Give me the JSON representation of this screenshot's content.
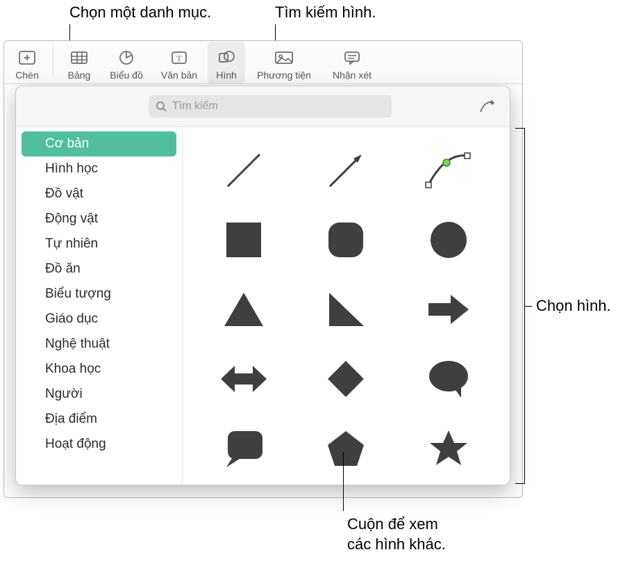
{
  "callouts": {
    "choose_category": "Chọn một danh mục.",
    "search_shapes": "Tìm kiếm hình.",
    "choose_shape": "Chọn hình.",
    "scroll_more": "Cuộn để xem\ncác hình khác."
  },
  "toolbar": {
    "insert": "Chèn",
    "table": "Bảng",
    "chart": "Biểu đồ",
    "text": "Văn bản",
    "shape": "Hình",
    "media": "Phương tiện",
    "comment": "Nhận xét"
  },
  "popover": {
    "search_placeholder": "Tìm kiếm",
    "categories": [
      "Cơ bản",
      "Hình học",
      "Đồ vật",
      "Động vật",
      "Tự nhiên",
      "Đồ ăn",
      "Biểu tượng",
      "Giáo dục",
      "Nghệ thuật",
      "Khoa học",
      "Người",
      "Địa điểm",
      "Hoạt động"
    ],
    "selected_category_index": 0,
    "shapes": [
      "line",
      "arrow-line",
      "bezier-curve",
      "square",
      "rounded-square",
      "circle",
      "triangle",
      "right-triangle",
      "arrow-right",
      "arrow-bidir",
      "diamond",
      "speech-bubble",
      "callout-rect",
      "pentagon",
      "star"
    ]
  },
  "colors": {
    "shape_fill": "#3f3f3f",
    "category_selected_bg": "#4fbf9f"
  }
}
